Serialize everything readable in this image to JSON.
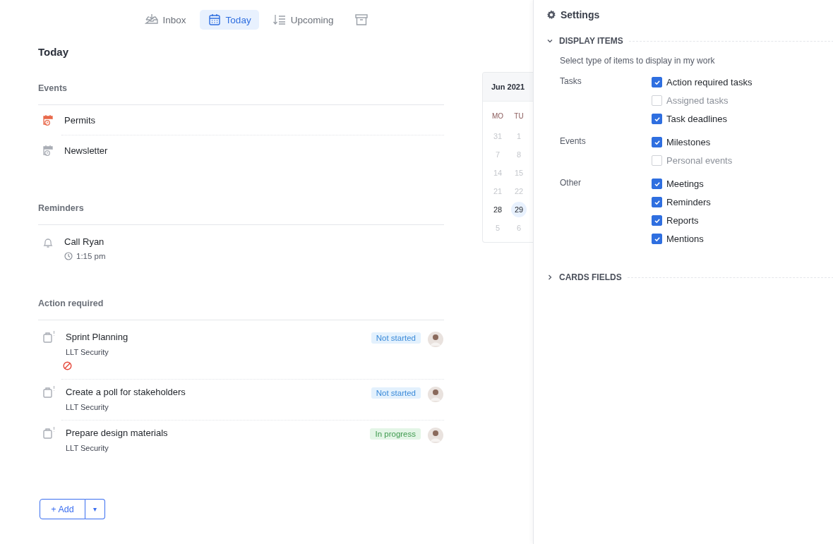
{
  "tabs": [
    {
      "label": "Inbox",
      "kind": "inbox",
      "selected": false
    },
    {
      "label": "Today",
      "kind": "calendar",
      "selected": true
    },
    {
      "label": "Upcoming",
      "kind": "sort",
      "selected": false
    },
    {
      "kind": "archive",
      "selected": false
    }
  ],
  "title": "Today",
  "events": {
    "heading": "Events",
    "items": [
      {
        "name": "Permits",
        "color": "#e8684a"
      },
      {
        "name": "Newsletter",
        "color": "#a9adb5"
      }
    ]
  },
  "reminders": {
    "heading": "Reminders",
    "items": [
      {
        "name": "Call Ryan",
        "time": "1:15 pm"
      }
    ]
  },
  "action_required": {
    "heading": "Action required",
    "items": [
      {
        "name": "Sprint Planning",
        "project": "LLT Security",
        "blocked": true,
        "status": "Not started",
        "kind": "not_started"
      },
      {
        "name": "Create a poll for stakeholders",
        "project": "LLT Security",
        "blocked": false,
        "status": "Not started",
        "kind": "not_started"
      },
      {
        "name": "Prepare design materials",
        "project": "LLT Security",
        "blocked": false,
        "status": "In progress",
        "kind": "in_progress"
      }
    ]
  },
  "add_button": {
    "label": "+ Add",
    "caret": "▾"
  },
  "calendar": {
    "month": "Jun 2021",
    "weekdays": [
      "MO",
      "TU"
    ],
    "weeks": [
      [
        {
          "day": "31",
          "muted": true,
          "selected": false
        },
        {
          "day": "1",
          "muted": true,
          "selected": false
        }
      ],
      [
        {
          "day": "7",
          "muted": true,
          "selected": false
        },
        {
          "day": "8",
          "muted": true,
          "selected": false
        }
      ],
      [
        {
          "day": "14",
          "muted": true,
          "selected": false
        },
        {
          "day": "15",
          "muted": true,
          "selected": false
        }
      ],
      [
        {
          "day": "21",
          "muted": true,
          "selected": false
        },
        {
          "day": "22",
          "muted": true,
          "selected": false
        }
      ],
      [
        {
          "day": "28",
          "muted": false,
          "selected": false
        },
        {
          "day": "29",
          "muted": false,
          "selected": true
        }
      ],
      [
        {
          "day": "5",
          "muted": true,
          "selected": false
        },
        {
          "day": "6",
          "muted": true,
          "selected": false
        }
      ]
    ]
  },
  "settings": {
    "title": "Settings",
    "sections": [
      {
        "title": "DISPLAY ITEMS",
        "expanded": true,
        "description": "Select type of items to display in my work",
        "groups": [
          {
            "label": "Tasks",
            "options": [
              {
                "label": "Action required tasks",
                "checked": true
              },
              {
                "label": "Assigned tasks",
                "checked": false
              },
              {
                "label": "Task deadlines",
                "checked": true
              }
            ]
          },
          {
            "label": "Events",
            "options": [
              {
                "label": "Milestones",
                "checked": true
              },
              {
                "label": "Personal events",
                "checked": false
              }
            ]
          },
          {
            "label": "Other",
            "options": [
              {
                "label": "Meetings",
                "checked": true
              },
              {
                "label": "Reminders",
                "checked": true
              },
              {
                "label": "Reports",
                "checked": true
              },
              {
                "label": "Mentions",
                "checked": true
              }
            ]
          }
        ]
      },
      {
        "title": "CARDS FIELDS",
        "expanded": false
      }
    ]
  }
}
